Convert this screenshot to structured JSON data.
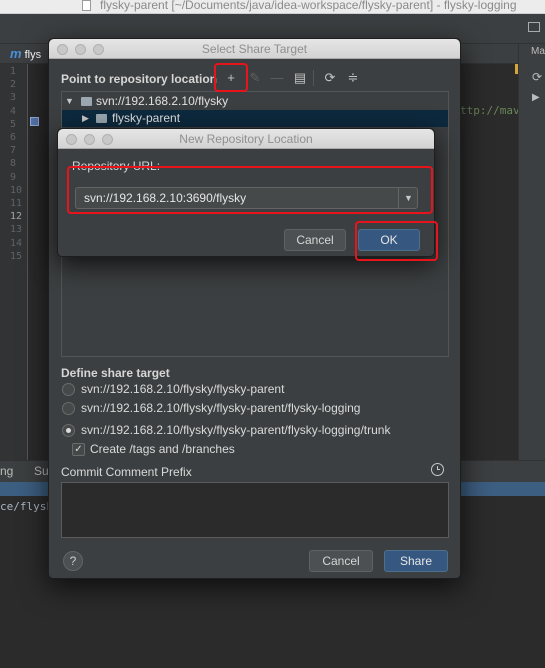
{
  "window": {
    "title": "flysky-parent [~/Documents/java/idea-workspace/flysky-parent] - flysky-logging"
  },
  "editor": {
    "tab_label": "flys",
    "line_numbers": [
      "1",
      "2",
      "3",
      "4",
      "5",
      "6",
      "7",
      "8",
      "9",
      "10",
      "11",
      "12",
      "13",
      "14",
      "15"
    ],
    "active_line": "12",
    "code_fragment": "ttp://maven"
  },
  "right_panel": {
    "label": "Ma"
  },
  "bottom": {
    "tab1": "ng",
    "tab2": "Su",
    "console_text": "ce/flysky-"
  },
  "share_dialog": {
    "title": "Select Share Target",
    "point_label": "Point to repository location",
    "toolbar_icons": [
      "add-icon",
      "edit-icon",
      "remove-icon",
      "copy-icon",
      "refresh-icon",
      "collapse-icon"
    ],
    "tree": [
      {
        "label": "svn://192.168.2.10/flysky",
        "expanded": true
      },
      {
        "label": "flysky-parent",
        "selected": true
      }
    ],
    "define_label": "Define share target",
    "options": [
      {
        "label": "svn://192.168.2.10/flysky/flysky-parent",
        "checked": false
      },
      {
        "label": "svn://192.168.2.10/flysky/flysky-parent/flysky-logging",
        "checked": false
      },
      {
        "label": "svn://192.168.2.10/flysky/flysky-parent/flysky-logging/trunk",
        "checked": true
      }
    ],
    "create_tags_label": "Create /tags and /branches",
    "create_tags_checked": true,
    "commit_prefix_label": "Commit Comment Prefix",
    "commit_prefix_value": "",
    "help_label": "?",
    "cancel_label": "Cancel",
    "share_label": "Share"
  },
  "repo_dialog": {
    "title": "New Repository Location",
    "url_label": "Repository URL:",
    "url_value": "svn://192.168.2.10:3690/flysky",
    "cancel_label": "Cancel",
    "ok_label": "OK"
  },
  "colors": {
    "highlight": "#e8141c",
    "accent_button": "#365880",
    "selection": "#0d293e"
  }
}
